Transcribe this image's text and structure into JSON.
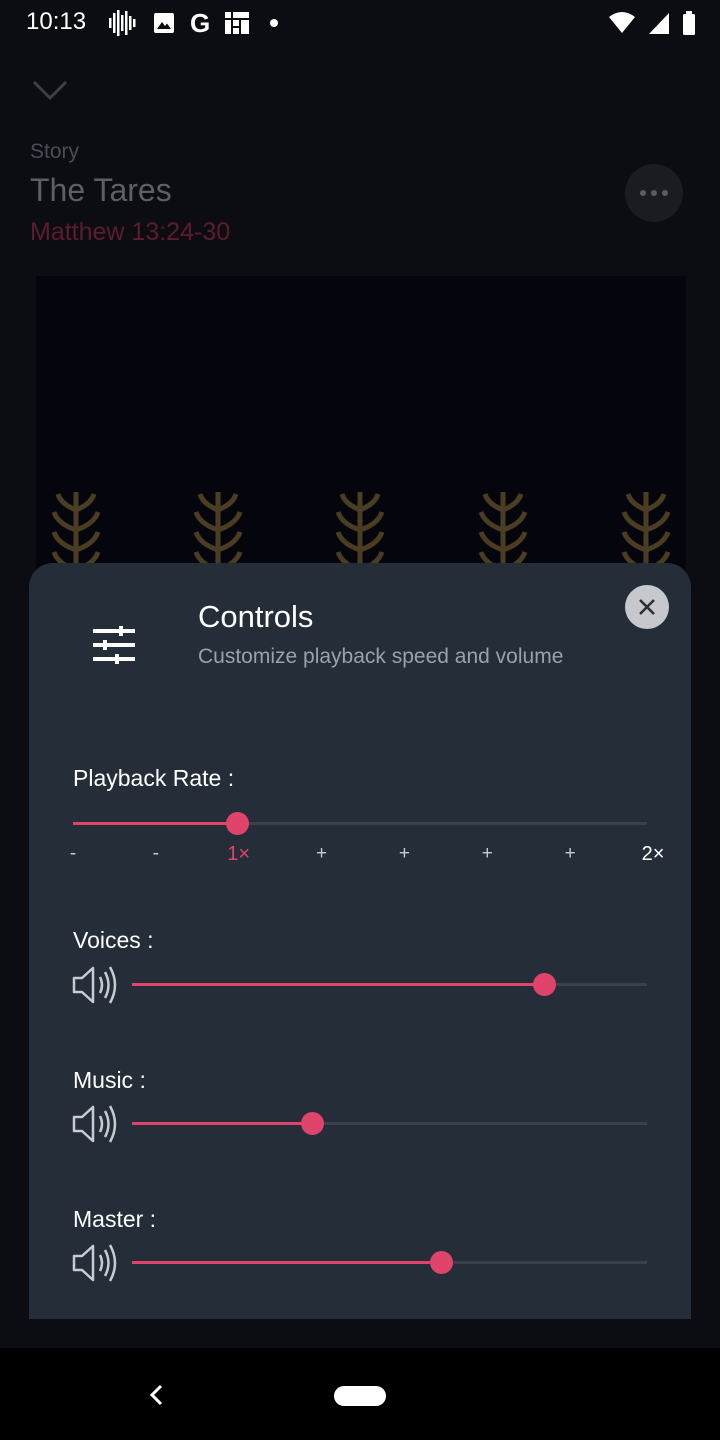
{
  "status_bar": {
    "time": "10:13",
    "google_letter": "G"
  },
  "background_page": {
    "kicker": "Story",
    "title": "The Tares",
    "reference": "Matthew 13:24-30"
  },
  "controls_sheet": {
    "title": "Controls",
    "subtitle": "Customize playback speed and volume",
    "playback_rate": {
      "label": "Playback Rate :",
      "value_fraction": 0.286,
      "ticks": [
        "-",
        "-",
        "1×",
        "+",
        "+",
        "+",
        "+",
        "2×"
      ],
      "active_tick_index": 2
    },
    "voices": {
      "label": "Voices :",
      "value_fraction": 0.8
    },
    "music": {
      "label": "Music :",
      "value_fraction": 0.35
    },
    "master": {
      "label": "Master :",
      "value_fraction": 0.6
    }
  },
  "colors": {
    "accent": "#e0436b",
    "sheet_background": "#252d38",
    "track": "#3a414c"
  },
  "icons": [
    "chevron-down-icon",
    "more-dots-icon",
    "sliders-icon",
    "close-icon",
    "speaker-icon",
    "back-icon"
  ]
}
